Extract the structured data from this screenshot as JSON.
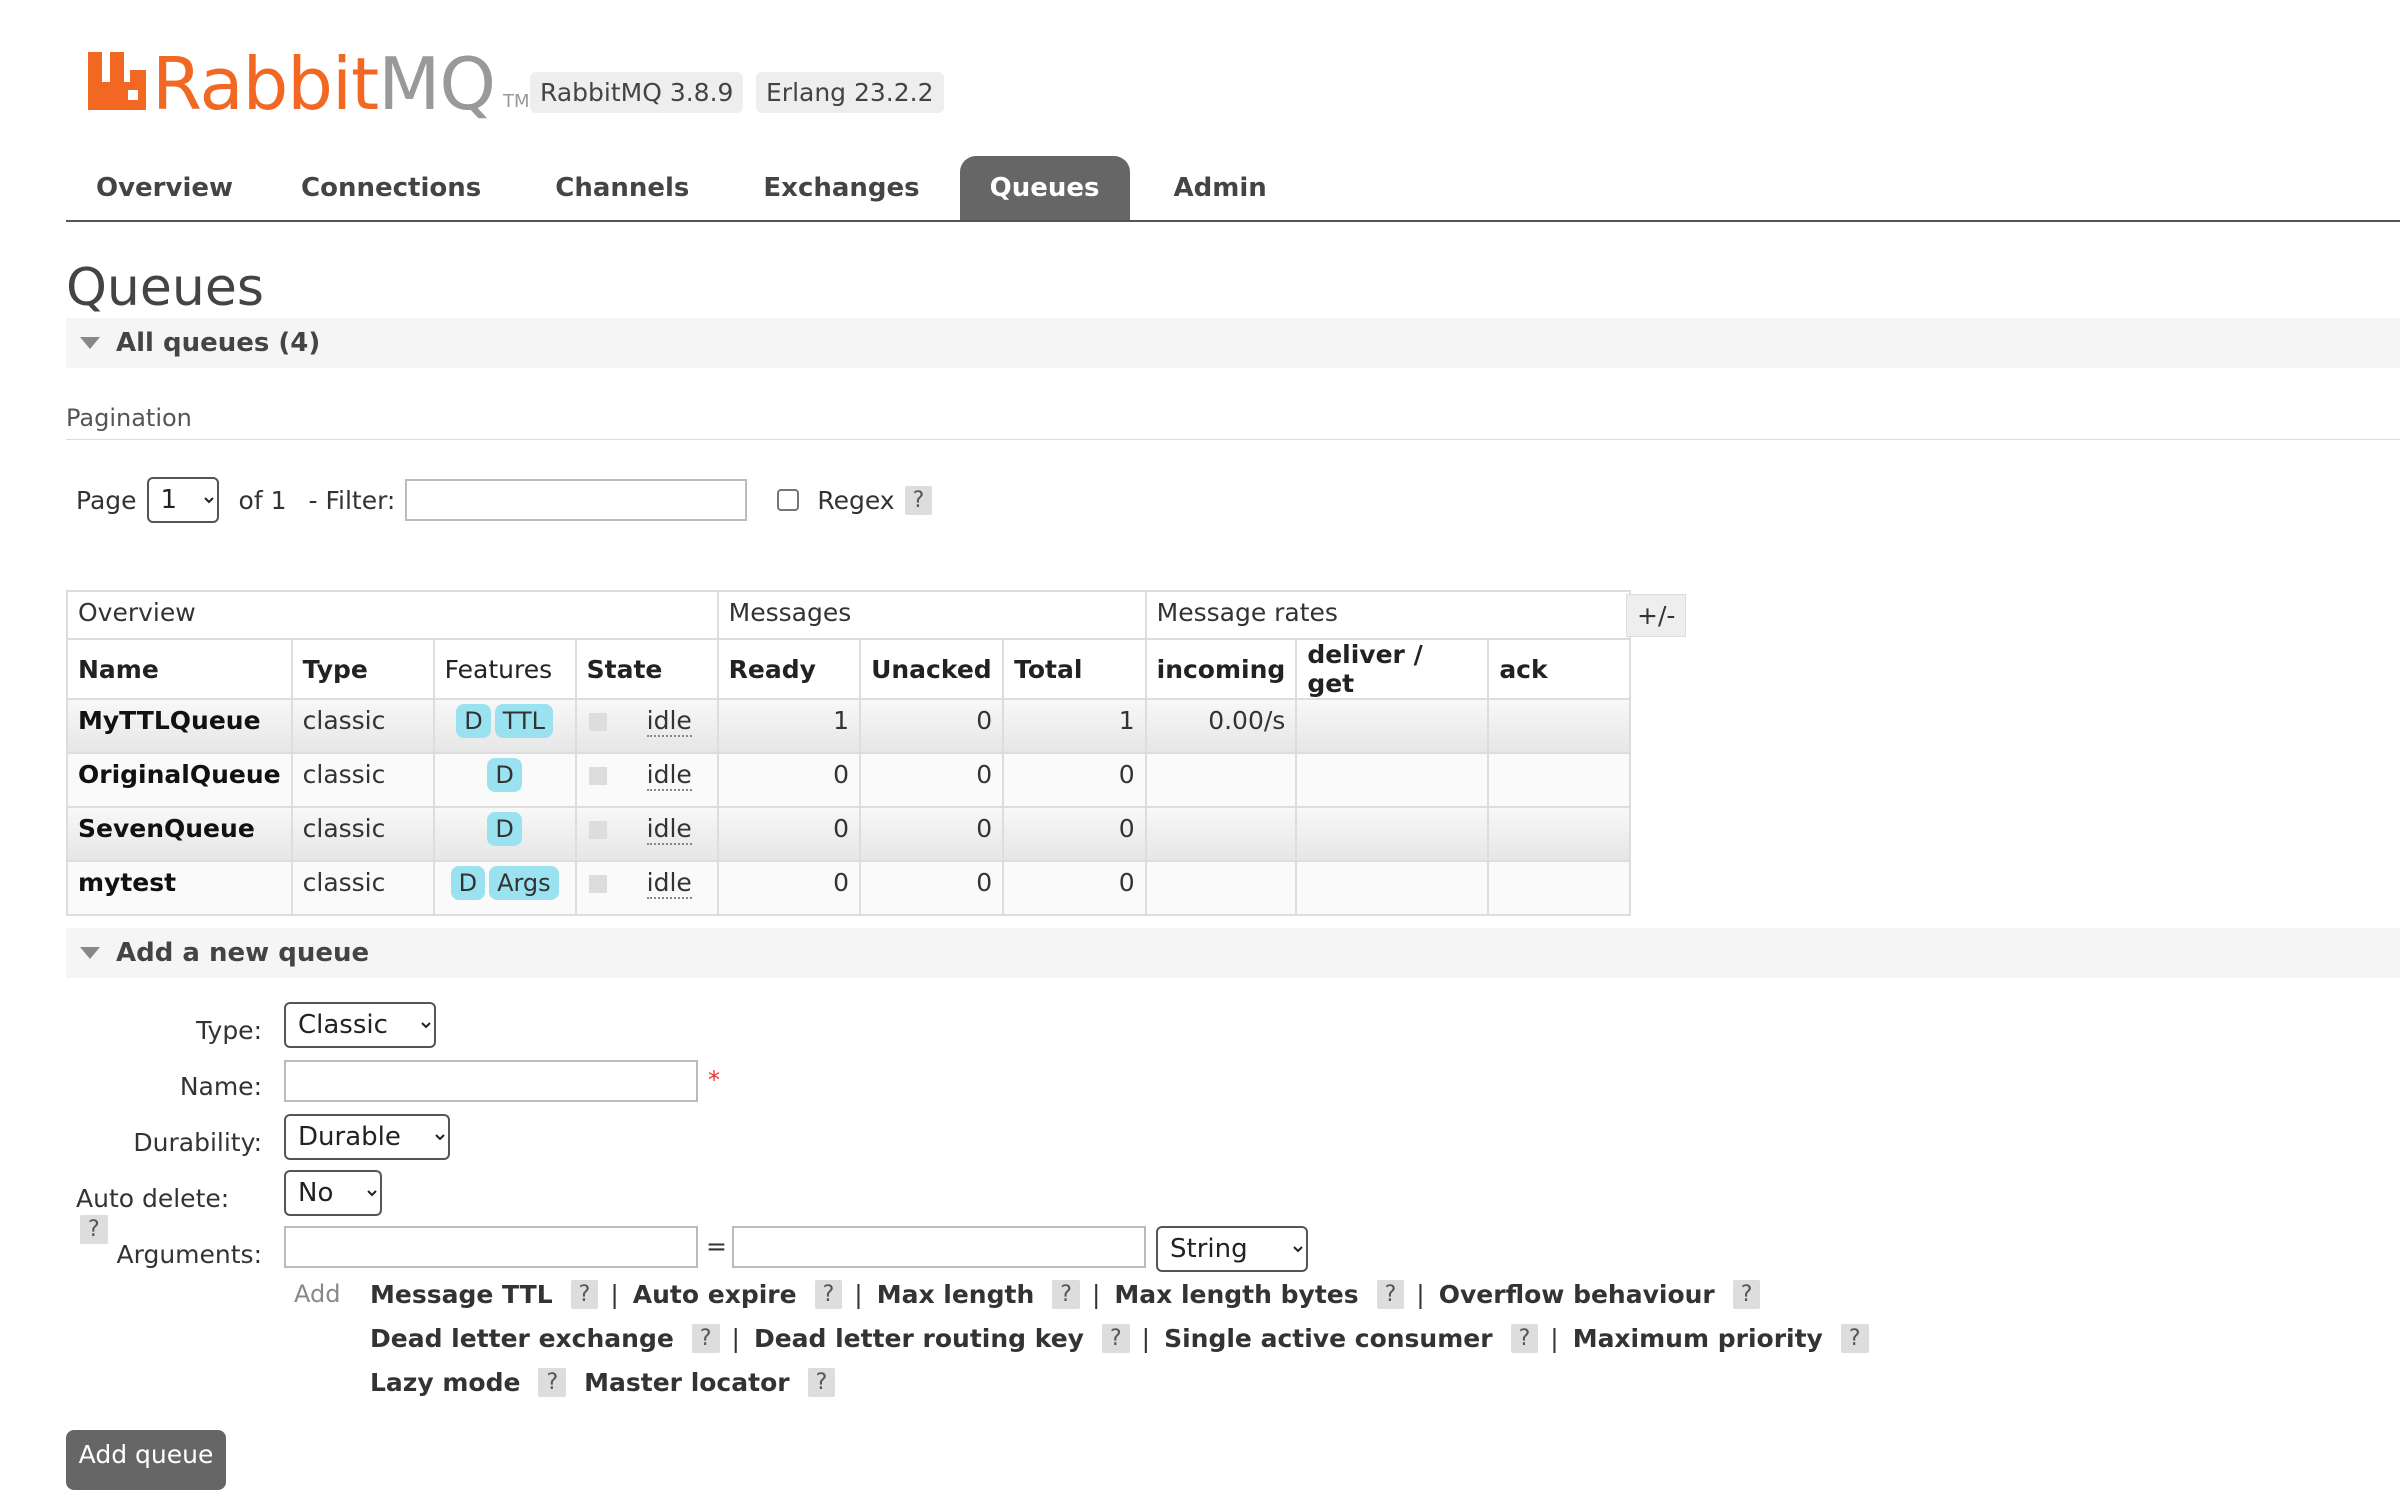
{
  "header": {
    "logo_main": "Rabbit",
    "logo_accent": "MQ",
    "logo_tm": "TM",
    "version": "RabbitMQ 3.8.9",
    "erlang": "Erlang 23.2.2"
  },
  "nav": {
    "tabs": [
      {
        "label": "Overview"
      },
      {
        "label": "Connections"
      },
      {
        "label": "Channels"
      },
      {
        "label": "Exchanges"
      },
      {
        "label": "Queues",
        "active": true
      },
      {
        "label": "Admin"
      }
    ]
  },
  "page": {
    "title": "Queues",
    "all_queues": "All queues (4)",
    "pagination_title": "Pagination",
    "page_label": "Page",
    "page_value": "1",
    "of_label": "of 1",
    "filter_label": "- Filter:",
    "filter_value": "",
    "regex_label": "Regex",
    "help": "?"
  },
  "table": {
    "groups": [
      "Overview",
      "Messages",
      "Message rates"
    ],
    "columns": [
      "Name",
      "Type",
      "Features",
      "State",
      "Ready",
      "Unacked",
      "Total",
      "incoming",
      "deliver / get",
      "ack"
    ],
    "toggle": "+/-",
    "rows": [
      {
        "name": "MyTTLQueue",
        "type": "classic",
        "features": [
          "D",
          "TTL"
        ],
        "state": "idle",
        "ready": "1",
        "unacked": "0",
        "total": "1",
        "incoming": "0.00/s",
        "deliver": "",
        "ack": ""
      },
      {
        "name": "OriginalQueue",
        "type": "classic",
        "features": [
          "D"
        ],
        "state": "idle",
        "ready": "0",
        "unacked": "0",
        "total": "0",
        "incoming": "",
        "deliver": "",
        "ack": ""
      },
      {
        "name": "SevenQueue",
        "type": "classic",
        "features": [
          "D"
        ],
        "state": "idle",
        "ready": "0",
        "unacked": "0",
        "total": "0",
        "incoming": "",
        "deliver": "",
        "ack": ""
      },
      {
        "name": "mytest",
        "type": "classic",
        "features": [
          "D",
          "Args"
        ],
        "state": "idle",
        "ready": "0",
        "unacked": "0",
        "total": "0",
        "incoming": "",
        "deliver": "",
        "ack": ""
      }
    ]
  },
  "add_queue": {
    "section": "Add a new queue",
    "type_label": "Type:",
    "type_value": "Classic",
    "name_label": "Name:",
    "name_value": "",
    "required": "*",
    "durability_label": "Durability:",
    "durability_value": "Durable",
    "auto_delete_label": "Auto delete:",
    "auto_delete_value": "No",
    "arguments_label": "Arguments:",
    "equals": "=",
    "arg_type_value": "String",
    "add_label": "Add",
    "links_row1": [
      "Message TTL",
      "Auto expire",
      "Max length",
      "Max length bytes",
      "Overflow behaviour"
    ],
    "links_row2": [
      "Dead letter exchange",
      "Dead letter routing key",
      "Single active consumer",
      "Maximum priority"
    ],
    "links_row3": [
      "Lazy mode",
      "Master locator"
    ],
    "submit": "Add queue"
  }
}
